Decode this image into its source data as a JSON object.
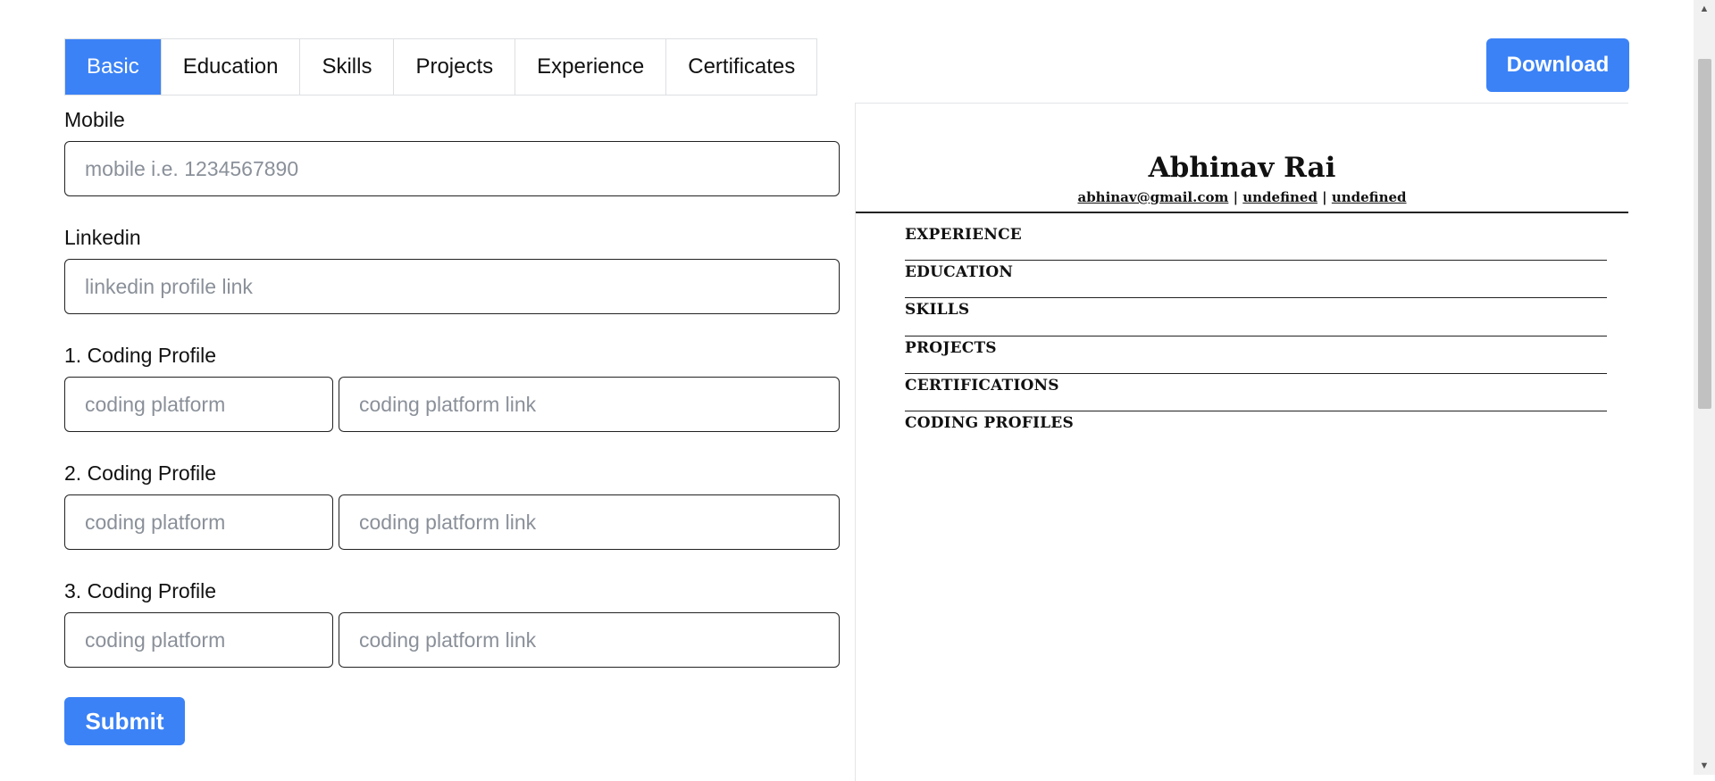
{
  "tabs": [
    {
      "label": "Basic",
      "active": true
    },
    {
      "label": "Education",
      "active": false
    },
    {
      "label": "Skills",
      "active": false
    },
    {
      "label": "Projects",
      "active": false
    },
    {
      "label": "Experience",
      "active": false
    },
    {
      "label": "Certificates",
      "active": false
    }
  ],
  "download_label": "Download",
  "form": {
    "mobile": {
      "label": "Mobile",
      "placeholder": "mobile i.e. 1234567890",
      "value": ""
    },
    "linkedin": {
      "label": "Linkedin",
      "placeholder": "linkedin profile link",
      "value": ""
    },
    "coding_profiles": [
      {
        "label": "1. Coding Profile",
        "platform_placeholder": "coding platform",
        "link_placeholder": "coding platform link"
      },
      {
        "label": "2. Coding Profile",
        "platform_placeholder": "coding platform",
        "link_placeholder": "coding platform link"
      },
      {
        "label": "3. Coding Profile",
        "platform_placeholder": "coding platform",
        "link_placeholder": "coding platform link"
      }
    ],
    "submit_label": "Submit"
  },
  "preview": {
    "name": "Abhinav Rai",
    "email": "abhinav@gmail.com",
    "separator": " | ",
    "link1": "undefined",
    "link2": "undefined",
    "sections": [
      "EXPERIENCE",
      "EDUCATION",
      "SKILLS",
      "PROJECTS",
      "CERTIFICATIONS",
      "CODING PROFILES"
    ]
  },
  "colors": {
    "accent": "#3b82f6",
    "text": "#111111",
    "placeholder": "#8a9099",
    "border": "#222222"
  },
  "icons": {
    "scroll_up": "triangle-up-icon",
    "scroll_down": "triangle-down-icon"
  }
}
